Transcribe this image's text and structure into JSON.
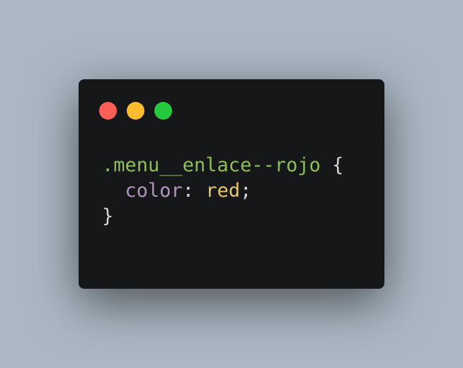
{
  "window": {
    "controls": {
      "close_color": "#ff5f56",
      "minimize_color": "#ffbd2e",
      "maximize_color": "#27c93f"
    }
  },
  "code": {
    "line1": {
      "selector": ".menu__enlace--rojo",
      "open_brace": "{"
    },
    "line2": {
      "indent": "  ",
      "property": "color",
      "colon": ":",
      "value": "red",
      "semicolon": ";"
    },
    "line3": {
      "close_brace": "}"
    }
  },
  "colors": {
    "background": "#abb8c3",
    "editor_background": "#161719",
    "selector": "#8fbf5a",
    "property": "#b294bb",
    "value": "#e6c86a",
    "punctuation": "#d6d6d6"
  }
}
